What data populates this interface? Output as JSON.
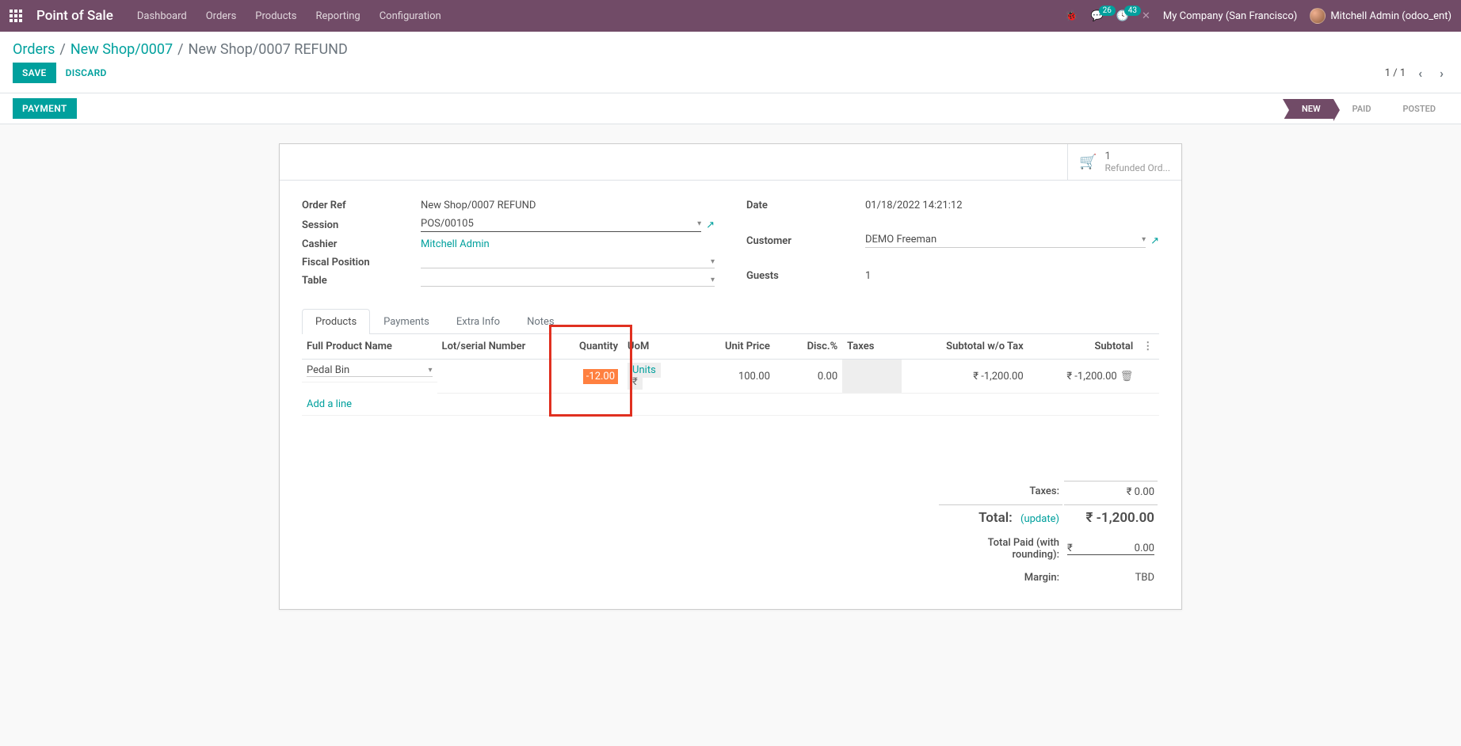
{
  "navbar": {
    "app_name": "Point of Sale",
    "menu": [
      "Dashboard",
      "Orders",
      "Products",
      "Reporting",
      "Configuration"
    ],
    "messages_count": "26",
    "activities_count": "43",
    "company": "My Company (San Francisco)",
    "user": "Mitchell Admin (odoo_ent)"
  },
  "breadcrumb": {
    "root": "Orders",
    "parent": "New Shop/0007",
    "current": "New Shop/0007 REFUND"
  },
  "controls": {
    "save": "Save",
    "discard": "Discard",
    "pager": "1 / 1",
    "payment": "Payment"
  },
  "status_steps": [
    "New",
    "Paid",
    "Posted"
  ],
  "stat_button": {
    "count": "1",
    "label": "Refunded Ord..."
  },
  "form": {
    "order_ref_label": "Order Ref",
    "order_ref": "New Shop/0007 REFUND",
    "session_label": "Session",
    "session": "POS/00105",
    "cashier_label": "Cashier",
    "cashier": "Mitchell Admin",
    "fiscal_label": "Fiscal Position",
    "fiscal": "",
    "table_label": "Table",
    "table": "",
    "date_label": "Date",
    "date": "01/18/2022 14:21:12",
    "customer_label": "Customer",
    "customer": "DEMO Freeman",
    "guests_label": "Guests",
    "guests": "1"
  },
  "tabs": [
    "Products",
    "Payments",
    "Extra Info",
    "Notes"
  ],
  "columns": {
    "product": "Full Product Name",
    "lot": "Lot/serial Number",
    "qty": "Quantity",
    "uom": "UoM",
    "price": "Unit Price",
    "disc": "Disc.%",
    "taxes": "Taxes",
    "subtotal_wo": "Subtotal w/o Tax",
    "subtotal": "Subtotal"
  },
  "line": {
    "product": "Pedal Bin",
    "qty": "-12.00",
    "uom": "Units",
    "unit_price": "100.00",
    "disc": "0.00",
    "subtotal_wo": "₹ -1,200.00",
    "subtotal": "₹ -1,200.00"
  },
  "add_line": "Add a line",
  "totals": {
    "taxes_label": "Taxes:",
    "taxes": "₹ 0.00",
    "total_label": "Total:",
    "update": "(update)",
    "total": "₹ -1,200.00",
    "paid_label": "Total Paid (with rounding):",
    "paid_symbol": "₹",
    "paid": "0.00",
    "margin_label": "Margin:",
    "margin": "TBD"
  }
}
